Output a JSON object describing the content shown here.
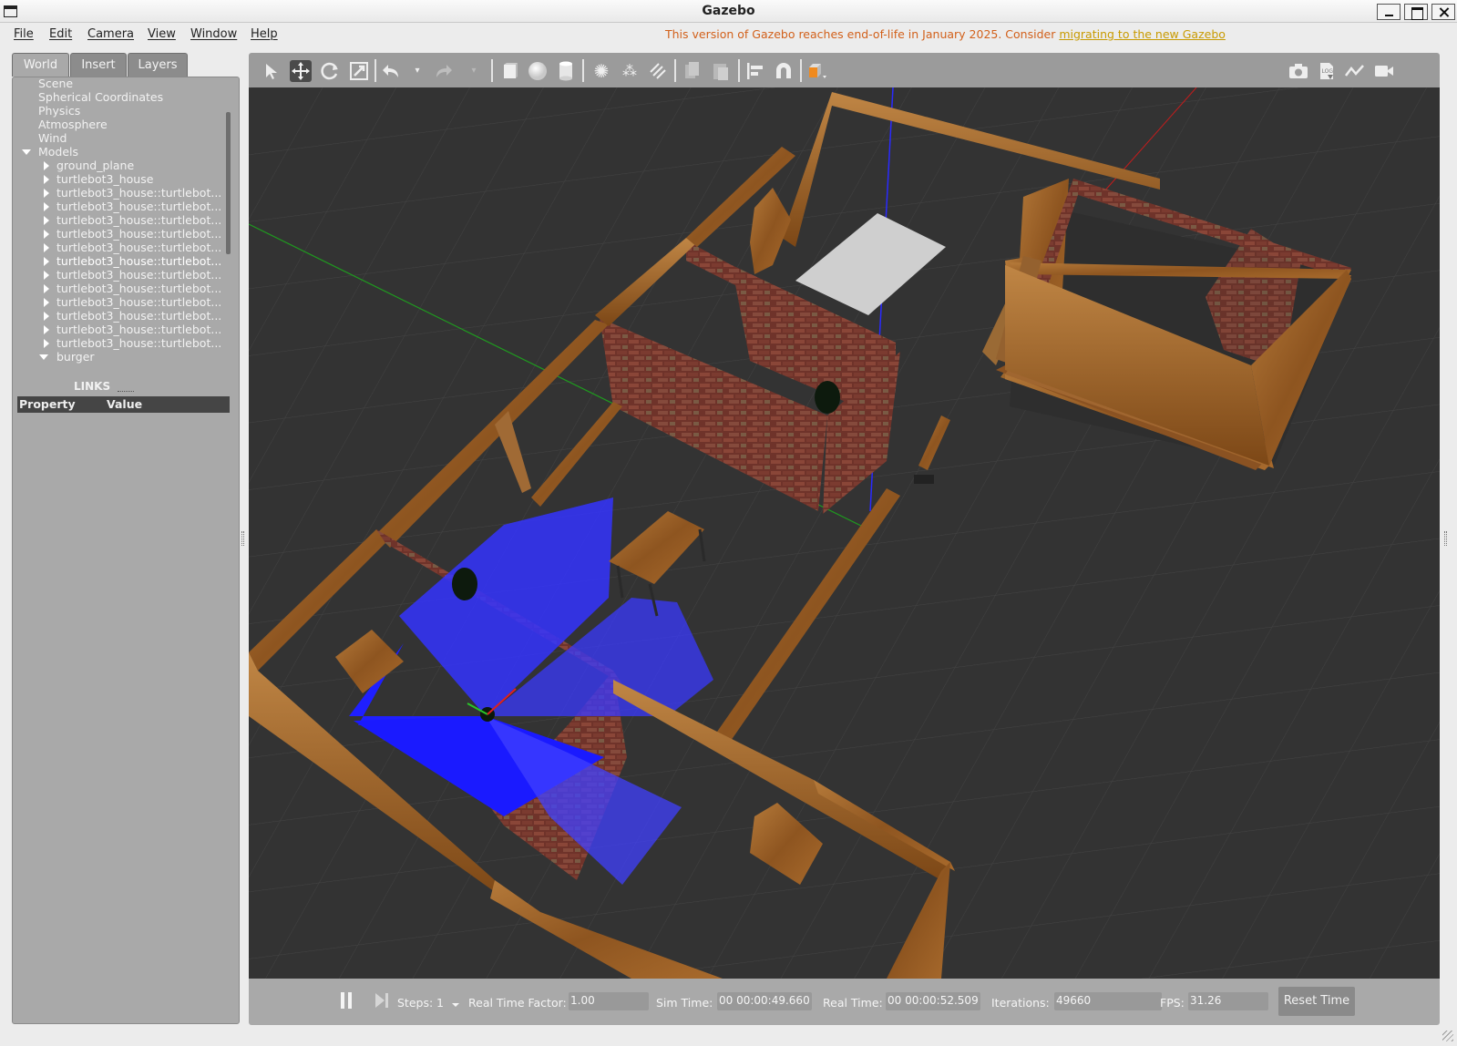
{
  "window": {
    "title": "Gazebo"
  },
  "menu": {
    "file": "File",
    "edit": "Edit",
    "camera": "Camera",
    "view": "View",
    "window": "Window",
    "help": "Help"
  },
  "notice": {
    "text": "This version of Gazebo reaches end-of-life in January 2025. Consider ",
    "link": "migrating to the new Gazebo"
  },
  "tabs": {
    "world": "World",
    "insert": "Insert",
    "layers": "Layers"
  },
  "tree": {
    "scene": "Scene",
    "spherical": "Spherical Coordinates",
    "physics": "Physics",
    "atmosphere": "Atmosphere",
    "wind": "Wind",
    "models": "Models",
    "items": [
      "ground_plane",
      "turtlebot3_house",
      "turtlebot3_house::turtlebot...",
      "turtlebot3_house::turtlebot...",
      "turtlebot3_house::turtlebot...",
      "turtlebot3_house::turtlebot...",
      "turtlebot3_house::turtlebot...",
      "turtlebot3_house::turtlebot...",
      "turtlebot3_house::turtlebot...",
      "turtlebot3_house::turtlebot...",
      "turtlebot3_house::turtlebot...",
      "turtlebot3_house::turtlebot...",
      "turtlebot3_house::turtlebot...",
      "turtlebot3_house::turtlebot..."
    ],
    "burger": "burger",
    "links": "LINKS"
  },
  "properties": {
    "property_col": "Property",
    "value_col": "Value"
  },
  "bottom": {
    "steps_label": "Steps:",
    "steps_value": "1",
    "rtf_label": "Real Time Factor:",
    "rtf_value": "1.00",
    "sim_time_label": "Sim Time:",
    "sim_time_value": "00 00:00:49.660",
    "real_time_label": "Real Time:",
    "real_time_value": "00 00:00:52.509",
    "iterations_label": "Iterations:",
    "iterations_value": "49660",
    "fps_label": "FPS:",
    "fps_value": "31.26",
    "reset_label": "Reset Time"
  },
  "icons": {
    "select": "select-arrow-icon",
    "translate": "translate-icon",
    "rotate": "rotate-icon",
    "scale": "scale-icon",
    "undo": "undo-icon",
    "redo": "redo-icon",
    "box": "box-icon",
    "sphere": "sphere-icon",
    "cylinder": "cylinder-icon",
    "point_light": "point-light-icon",
    "spot_light": "spot-light-icon",
    "dir_light": "directional-light-icon",
    "copy": "copy-icon",
    "paste": "paste-icon",
    "align": "align-icon",
    "snap": "snap-magnet-icon",
    "view_angle": "view-angle-icon",
    "screenshot": "camera-icon",
    "log": "log-icon",
    "plot": "plot-icon",
    "record": "video-record-icon"
  },
  "colors": {
    "notice": "#d2601a",
    "link": "#c89a00",
    "laser": "#1f1fff",
    "wood": "#9a5f25",
    "brick": "#7a3a30"
  }
}
